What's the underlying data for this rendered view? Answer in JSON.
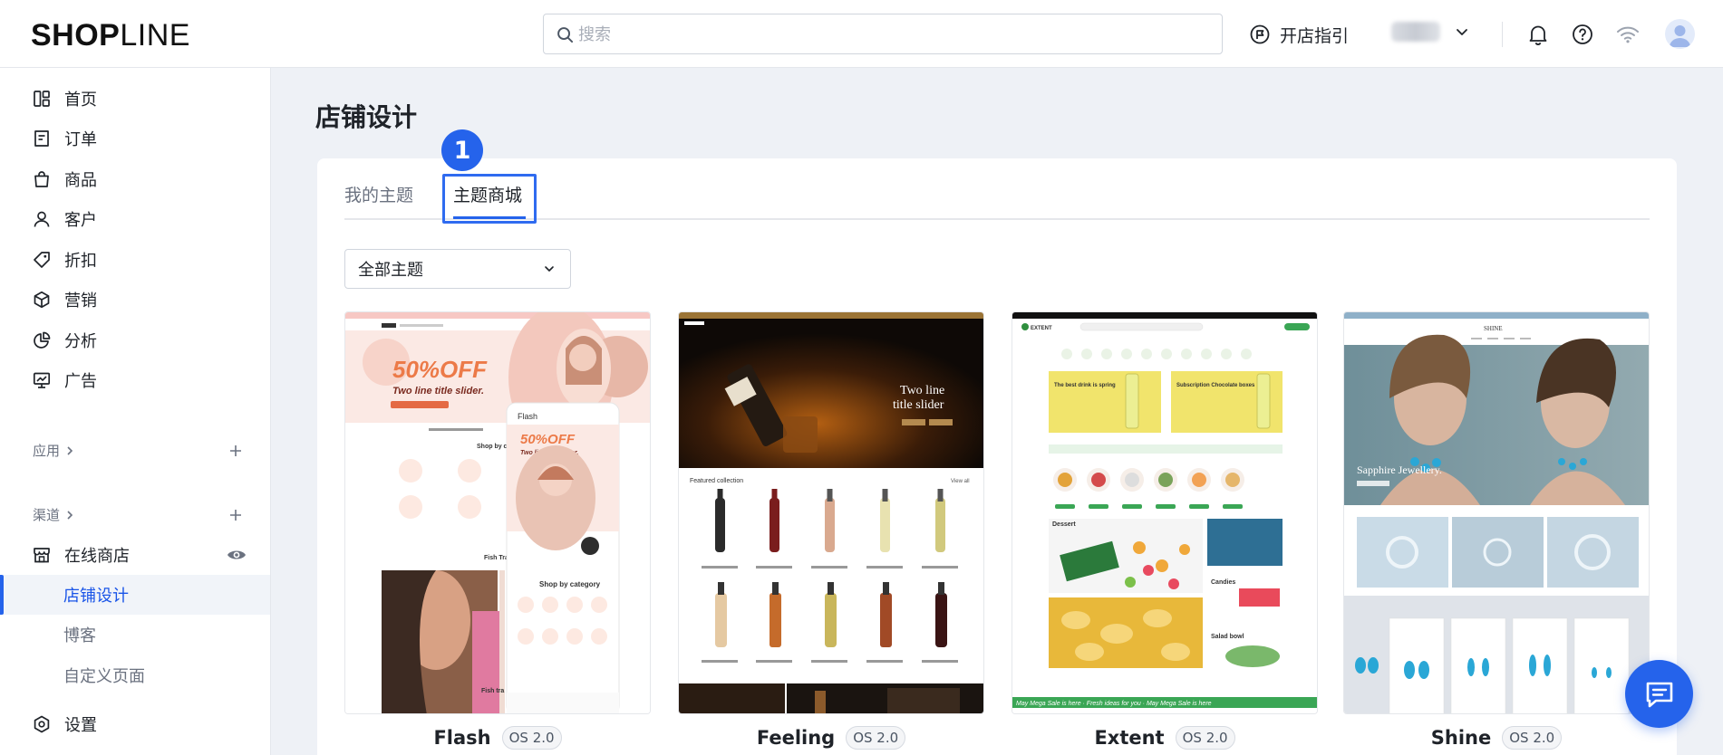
{
  "header": {
    "logo_bold": "SHOP",
    "logo_light": "LINE",
    "search_placeholder": "搜索",
    "guide_label": "开店指引",
    "icons": [
      "search-icon",
      "flag-icon",
      "chevron-down-icon",
      "bell-icon",
      "help-icon",
      "wifi-icon",
      "user-avatar-icon"
    ]
  },
  "sidebar": {
    "items": [
      {
        "label": "首页",
        "icon": "home-icon"
      },
      {
        "label": "订单",
        "icon": "order-icon"
      },
      {
        "label": "商品",
        "icon": "bag-icon"
      },
      {
        "label": "客户",
        "icon": "user-icon"
      },
      {
        "label": "折扣",
        "icon": "tag-icon"
      },
      {
        "label": "营销",
        "icon": "cube-icon"
      },
      {
        "label": "分析",
        "icon": "pie-chart-icon"
      },
      {
        "label": "广告",
        "icon": "monitor-icon"
      }
    ],
    "apps_label": "应用",
    "channels_label": "渠道",
    "online_store_label": "在线商店",
    "sub_items": [
      {
        "label": "店铺设计",
        "active": true
      },
      {
        "label": "博客",
        "active": false
      },
      {
        "label": "自定义页面",
        "active": false
      }
    ],
    "settings_label": "设置"
  },
  "main": {
    "page_title": "店铺设计",
    "tabs": [
      {
        "label": "我的主题",
        "active": false
      },
      {
        "label": "主题商城",
        "active": true
      }
    ],
    "step_badge": "1",
    "filter_label": "全部主题",
    "themes": [
      {
        "name": "Flash",
        "tag": "OS 2.0",
        "preview": {
          "discount_text": "50%OFF",
          "slider_text": "Two line title slider.",
          "mobile_brand": "Flash",
          "mobile_section": "Shop by category",
          "desktop_section": "Shop by ca",
          "footer_left": "Fish Tra",
          "footer_right": "Fish tra"
        }
      },
      {
        "name": "Feeling",
        "tag": "OS 2.0",
        "preview": {
          "hero_text_1": "Two line",
          "hero_text_2": "title slider",
          "collection_title": "Featured collection",
          "view_all": "View all"
        }
      },
      {
        "name": "Extent",
        "tag": "OS 2.0",
        "preview": {
          "logo_text": "EXTENT",
          "banner_1": "The best drink is spring",
          "banner_2": "Subscription Chocolate boxes",
          "section_dessert": "Dessert",
          "section_candies": "Candies",
          "section_salad": "Salad bowl",
          "marquee": "May Mega Sale is here  ·  Fresh ideas for you  ·  May Mega Sale is here"
        }
      },
      {
        "name": "Shine",
        "tag": "OS 2.0",
        "preview": {
          "logo_text": "SHINE",
          "hero_text": "Sapphire Jewellery."
        }
      }
    ]
  },
  "colors": {
    "accent": "#2563eb",
    "background": "#eef1f6",
    "surface": "#ffffff",
    "muted_text": "#6b7280"
  }
}
